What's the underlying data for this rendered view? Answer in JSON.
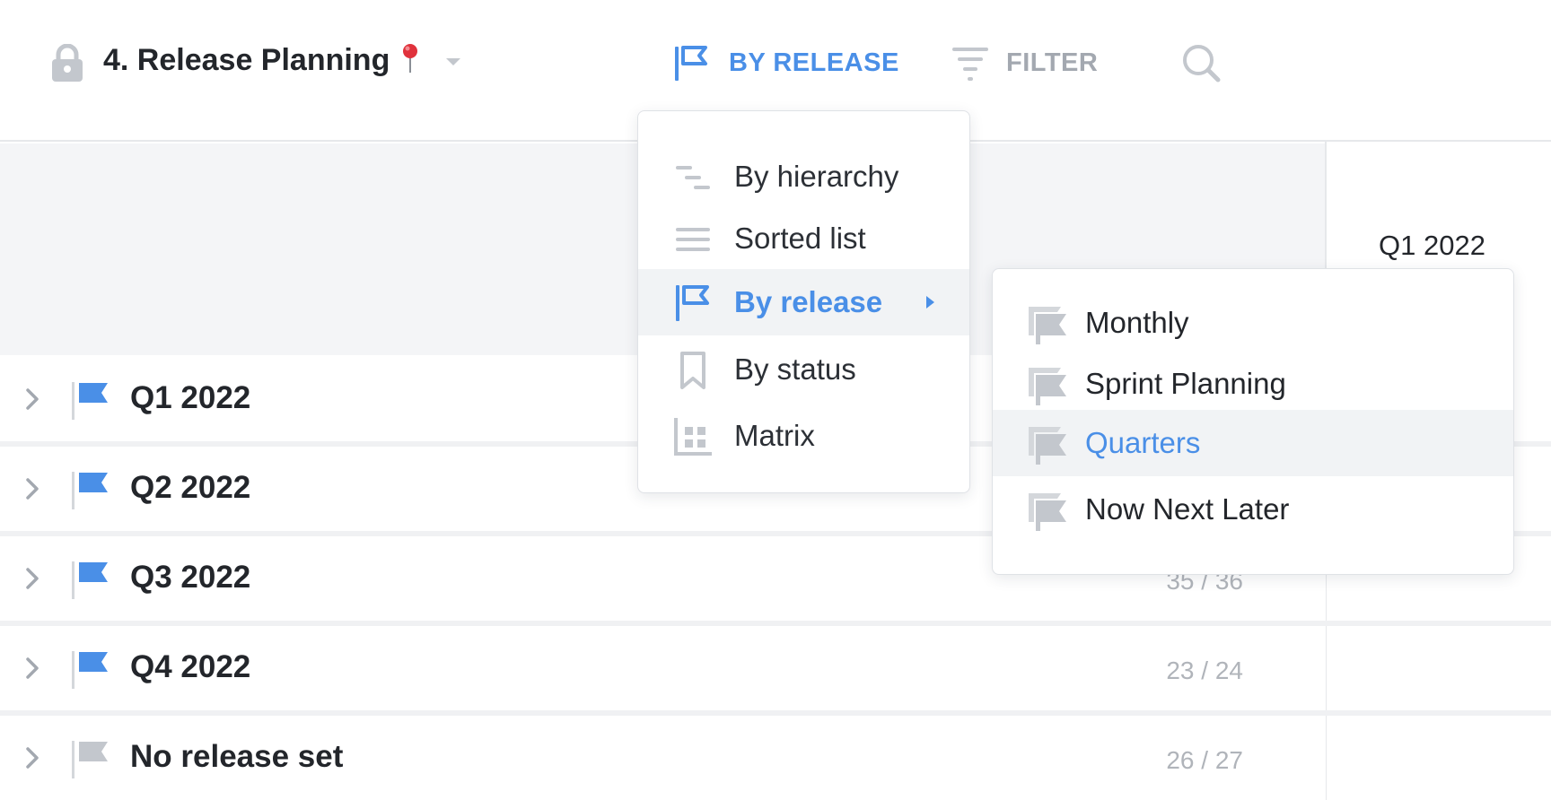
{
  "toolbar": {
    "view_title": "4. Release Planning",
    "by_release_label": "BY RELEASE",
    "filter_label": "FILTER"
  },
  "colors": {
    "accent": "#4a8fe7",
    "muted": "#a3a8b0",
    "header_bg": "#f4f5f7",
    "icon_gray": "#c3c7cd"
  },
  "timeline": {
    "column_label": "Q1 2022"
  },
  "rows": [
    {
      "label": "Q1 2022",
      "count": "",
      "flag_color": "#4a8fe7"
    },
    {
      "label": "Q2 2022",
      "count": "",
      "flag_color": "#4a8fe7"
    },
    {
      "label": "Q3 2022",
      "count": "35 / 36",
      "flag_color": "#4a8fe7"
    },
    {
      "label": "Q4 2022",
      "count": "23 / 24",
      "flag_color": "#4a8fe7"
    },
    {
      "label": "No release set",
      "count": "26 / 27",
      "flag_color": "#c3c7cd"
    }
  ],
  "view_menu": {
    "items": [
      {
        "label": "By hierarchy",
        "icon": "hierarchy-icon"
      },
      {
        "label": "Sorted list",
        "icon": "list-icon"
      },
      {
        "label": "By release",
        "icon": "release-flag-icon",
        "active": true
      },
      {
        "label": "By status",
        "icon": "bookmark-icon"
      },
      {
        "label": "Matrix",
        "icon": "matrix-icon"
      }
    ]
  },
  "release_submenu": {
    "items": [
      {
        "label": "Monthly",
        "icon": "release-set-icon"
      },
      {
        "label": "Sprint Planning",
        "icon": "release-set-icon"
      },
      {
        "label": "Quarters",
        "icon": "release-set-icon",
        "active": true
      },
      {
        "label": "Now Next Later",
        "icon": "release-set-icon"
      }
    ]
  }
}
